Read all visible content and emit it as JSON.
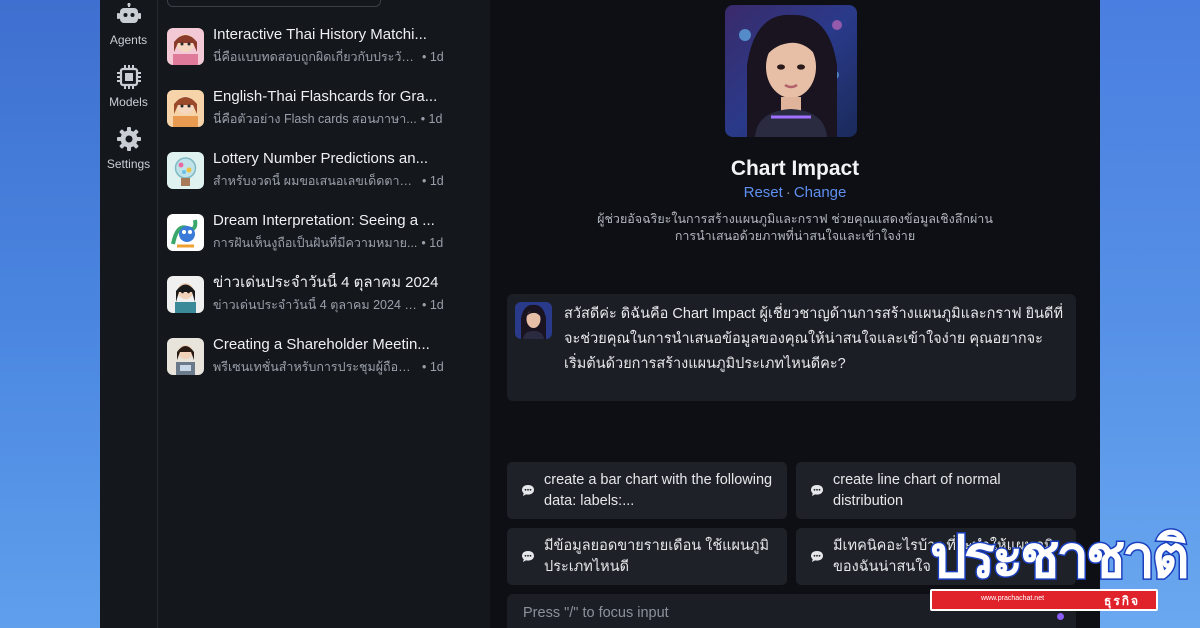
{
  "rail": {
    "items": [
      {
        "label": "Agents",
        "icon": "robot-icon"
      },
      {
        "label": "Models",
        "icon": "chip-icon"
      },
      {
        "label": "Settings",
        "icon": "gear-icon"
      }
    ]
  },
  "conversations": [
    {
      "title": "Interactive Thai History Matchi...",
      "snippet": "นี่คือแบบทดสอบถูกผิดเกี่ยวกับประวัติ...",
      "age": "• 1d"
    },
    {
      "title": "English-Thai Flashcards for Gra...",
      "snippet": "นี่คือตัวอย่าง Flash cards สอนภาษา...",
      "age": "• 1d"
    },
    {
      "title": "Lottery Number Predictions an...",
      "snippet": "สำหรับงวดนี้ ผมขอเสนอเลขเด็ดตามก...",
      "age": "• 1d"
    },
    {
      "title": "Dream Interpretation: Seeing a ...",
      "snippet": "การฝันเห็นงูถือเป็นฝันที่มีความหมาย...",
      "age": "• 1d"
    },
    {
      "title": "ข่าวเด่นประจำวันนี้ 4 ตุลาคม 2024",
      "snippet": "ข่าวเด่นประจำวันนี้ 4 ตุลาคม 2024 มี...",
      "age": "• 1d"
    },
    {
      "title": "Creating a Shareholder Meetin...",
      "snippet": "พรีเซนเทชั่นสำหรับการประชุมผู้ถือหุ้น...",
      "age": "• 1d"
    }
  ],
  "agent": {
    "name": "Chart Impact",
    "reset_label": "Reset",
    "separator": "·",
    "change_label": "Change",
    "description": "ผู้ช่วยอัจฉริยะในการสร้างแผนภูมิและกราฟ ช่วยคุณแสดงข้อมูลเชิงลึกผ่านการนำเสนอด้วยภาพที่น่าสนใจและเข้าใจง่าย"
  },
  "message": {
    "text": "สวัสดีค่ะ ดิฉันคือ Chart Impact ผู้เชี่ยวชาญด้านการสร้างแผนภูมิและกราฟ ยินดีที่จะช่วยคุณในการนำเสนอข้อมูลของคุณให้น่าสนใจและเข้าใจง่าย คุณอยากจะเริ่มต้นด้วยการสร้างแผนภูมิประเภทไหนดีคะ?"
  },
  "suggestions": [
    {
      "text": "create a bar chart with the following data: labels:..."
    },
    {
      "text": "create line chart of normal distribution"
    },
    {
      "text": "มีข้อมูลยอดขายรายเดือน ใช้แผนภูมิประเภทไหนดี"
    },
    {
      "text": "มีเทคนิคอะไรบ้าง ที่จะทำให้แผนภูมิของฉันน่าสนใจ"
    }
  ],
  "input": {
    "placeholder": "Press \"/\" to focus input"
  },
  "logo": {
    "wordmark": "ประชาชาติ",
    "url": "www.prachachat.net",
    "sub": "ธุรกิจ"
  },
  "colors": {
    "accent_link": "#5f8ff0",
    "app_bg": "#0f1116",
    "panel_bg": "#14171c",
    "card_bg": "#1e2127",
    "send_dot": "#8b5cf6",
    "logo_blue": "#1a3fbf",
    "logo_red": "#e0222b"
  }
}
